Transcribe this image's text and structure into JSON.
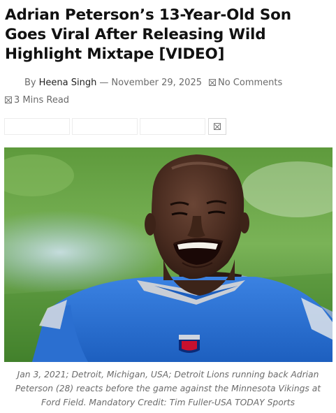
{
  "article": {
    "title": "Adrian Peterson’s 13-Year-Old Son Goes Viral After Releasing Wild Highlight Mixtape [VIDEO]",
    "byline_prefix": "By",
    "author": "Heena Singh",
    "separator": "—",
    "date": "November 29, 2025",
    "comments_label": "No Comments",
    "read_time": "3 Mins Read"
  },
  "image": {
    "caption": "Jan 3, 2021; Detroit, Michigan, USA; Detroit Lions running back Adrian Peterson (28) reacts before the game against the Minnesota Vikings at Ford Field. Mandatory Credit: Tim Fuller-USA TODAY Sports"
  },
  "colors": {
    "jersey_blue": "#2f74d6",
    "field_green": "#5f9e3a",
    "meta_gray": "#6b6b6b"
  }
}
